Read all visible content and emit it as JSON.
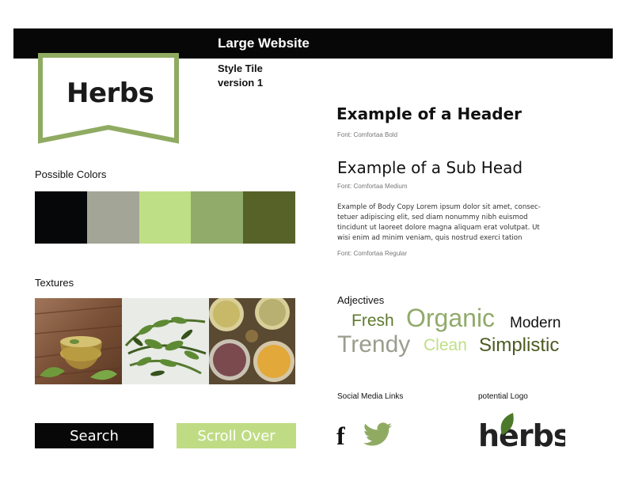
{
  "header": {
    "title": "Large Website"
  },
  "logo": {
    "text": "Herbs"
  },
  "tile": {
    "line1": "Style Tile",
    "line2": "version 1"
  },
  "colors": {
    "label": "Possible Colors",
    "swatches": [
      "#050708",
      "#a3a696",
      "#bfdf86",
      "#91ab6a",
      "#566228"
    ]
  },
  "textures": {
    "label": "Textures"
  },
  "buttons": {
    "search_label": "Search",
    "scroll_label": "Scroll Over"
  },
  "typography": {
    "header": "Example of a Header",
    "header_font": "Font: Comfortaa Bold",
    "subhead": "Example of a Sub Head",
    "subhead_font": "Font: Comfortaa Medium",
    "body_lines": [
      "Example of Body Copy Lorem ipsum dolor sit amet, consec-",
      "tetuer adipiscing elit, sed diam nonummy nibh euismod",
      "tincidunt ut laoreet dolore magna aliquam erat volutpat. Ut",
      "wisi enim ad minim veniam, quis nostrud exerci tation"
    ],
    "body_font": "Font: Comfortaa Regular"
  },
  "adjectives": {
    "label": "Adjectives",
    "words": [
      {
        "text": "Fresh",
        "color": "#5f7a2c"
      },
      {
        "text": "Organic",
        "color": "#91ab6a"
      },
      {
        "text": "Modern",
        "color": "#111111"
      },
      {
        "text": "Trendy",
        "color": "#9a9d8d"
      },
      {
        "text": "Clean",
        "color": "#bfdf86"
      },
      {
        "text": "Simplistic",
        "color": "#4d5a22"
      }
    ]
  },
  "social": {
    "label": "Social Media Links",
    "facebook_glyph": "f",
    "icons": [
      "facebook-icon",
      "twitter-icon"
    ]
  },
  "potential_logo": {
    "label": "potential Logo",
    "text": "herbs"
  }
}
